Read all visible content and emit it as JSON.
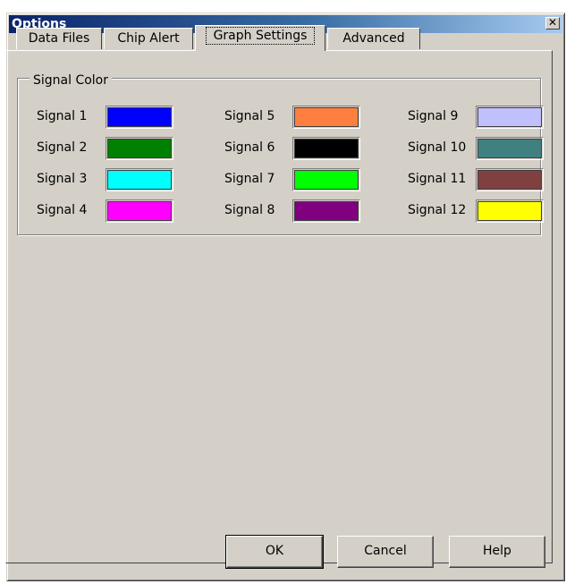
{
  "window": {
    "title": "Options"
  },
  "tabs": [
    {
      "label": "Data Files"
    },
    {
      "label": "Chip Alert"
    },
    {
      "label": "Graph Settings",
      "active": true
    },
    {
      "label": "Advanced"
    }
  ],
  "group": {
    "label": "Signal Color"
  },
  "signals": [
    {
      "label": "Signal 1",
      "color": "#0000ff"
    },
    {
      "label": "Signal 2",
      "color": "#008000"
    },
    {
      "label": "Signal 3",
      "color": "#00ffff"
    },
    {
      "label": "Signal 4",
      "color": "#ff00ff"
    },
    {
      "label": "Signal 5",
      "color": "#ff7f40"
    },
    {
      "label": "Signal 6",
      "color": "#000000"
    },
    {
      "label": "Signal 7",
      "color": "#00ff00"
    },
    {
      "label": "Signal 8",
      "color": "#800080"
    },
    {
      "label": "Signal 9",
      "color": "#c0c0ff"
    },
    {
      "label": "Signal 10",
      "color": "#408080"
    },
    {
      "label": "Signal 11",
      "color": "#804040"
    },
    {
      "label": "Signal 12",
      "color": "#ffff00"
    }
  ],
  "buttons": {
    "ok": "OK",
    "cancel": "Cancel",
    "help": "Help"
  },
  "icons": {
    "close": "close-icon"
  }
}
